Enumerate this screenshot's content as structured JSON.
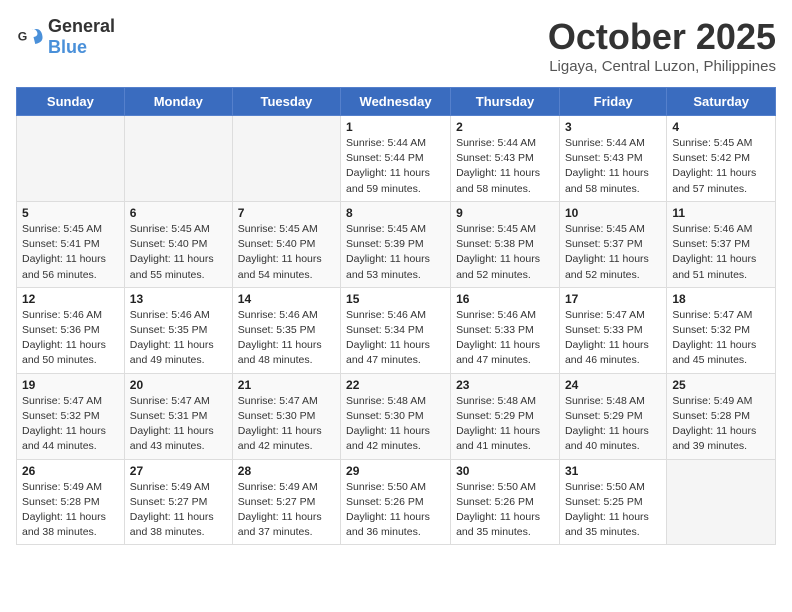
{
  "logo": {
    "text_general": "General",
    "text_blue": "Blue"
  },
  "header": {
    "month": "October 2025",
    "location": "Ligaya, Central Luzon, Philippines"
  },
  "weekdays": [
    "Sunday",
    "Monday",
    "Tuesday",
    "Wednesday",
    "Thursday",
    "Friday",
    "Saturday"
  ],
  "weeks": [
    [
      {
        "day": "",
        "sunrise": "",
        "sunset": "",
        "daylight": ""
      },
      {
        "day": "",
        "sunrise": "",
        "sunset": "",
        "daylight": ""
      },
      {
        "day": "",
        "sunrise": "",
        "sunset": "",
        "daylight": ""
      },
      {
        "day": "1",
        "sunrise": "Sunrise: 5:44 AM",
        "sunset": "Sunset: 5:44 PM",
        "daylight": "Daylight: 11 hours and 59 minutes."
      },
      {
        "day": "2",
        "sunrise": "Sunrise: 5:44 AM",
        "sunset": "Sunset: 5:43 PM",
        "daylight": "Daylight: 11 hours and 58 minutes."
      },
      {
        "day": "3",
        "sunrise": "Sunrise: 5:44 AM",
        "sunset": "Sunset: 5:43 PM",
        "daylight": "Daylight: 11 hours and 58 minutes."
      },
      {
        "day": "4",
        "sunrise": "Sunrise: 5:45 AM",
        "sunset": "Sunset: 5:42 PM",
        "daylight": "Daylight: 11 hours and 57 minutes."
      }
    ],
    [
      {
        "day": "5",
        "sunrise": "Sunrise: 5:45 AM",
        "sunset": "Sunset: 5:41 PM",
        "daylight": "Daylight: 11 hours and 56 minutes."
      },
      {
        "day": "6",
        "sunrise": "Sunrise: 5:45 AM",
        "sunset": "Sunset: 5:40 PM",
        "daylight": "Daylight: 11 hours and 55 minutes."
      },
      {
        "day": "7",
        "sunrise": "Sunrise: 5:45 AM",
        "sunset": "Sunset: 5:40 PM",
        "daylight": "Daylight: 11 hours and 54 minutes."
      },
      {
        "day": "8",
        "sunrise": "Sunrise: 5:45 AM",
        "sunset": "Sunset: 5:39 PM",
        "daylight": "Daylight: 11 hours and 53 minutes."
      },
      {
        "day": "9",
        "sunrise": "Sunrise: 5:45 AM",
        "sunset": "Sunset: 5:38 PM",
        "daylight": "Daylight: 11 hours and 52 minutes."
      },
      {
        "day": "10",
        "sunrise": "Sunrise: 5:45 AM",
        "sunset": "Sunset: 5:37 PM",
        "daylight": "Daylight: 11 hours and 52 minutes."
      },
      {
        "day": "11",
        "sunrise": "Sunrise: 5:46 AM",
        "sunset": "Sunset: 5:37 PM",
        "daylight": "Daylight: 11 hours and 51 minutes."
      }
    ],
    [
      {
        "day": "12",
        "sunrise": "Sunrise: 5:46 AM",
        "sunset": "Sunset: 5:36 PM",
        "daylight": "Daylight: 11 hours and 50 minutes."
      },
      {
        "day": "13",
        "sunrise": "Sunrise: 5:46 AM",
        "sunset": "Sunset: 5:35 PM",
        "daylight": "Daylight: 11 hours and 49 minutes."
      },
      {
        "day": "14",
        "sunrise": "Sunrise: 5:46 AM",
        "sunset": "Sunset: 5:35 PM",
        "daylight": "Daylight: 11 hours and 48 minutes."
      },
      {
        "day": "15",
        "sunrise": "Sunrise: 5:46 AM",
        "sunset": "Sunset: 5:34 PM",
        "daylight": "Daylight: 11 hours and 47 minutes."
      },
      {
        "day": "16",
        "sunrise": "Sunrise: 5:46 AM",
        "sunset": "Sunset: 5:33 PM",
        "daylight": "Daylight: 11 hours and 47 minutes."
      },
      {
        "day": "17",
        "sunrise": "Sunrise: 5:47 AM",
        "sunset": "Sunset: 5:33 PM",
        "daylight": "Daylight: 11 hours and 46 minutes."
      },
      {
        "day": "18",
        "sunrise": "Sunrise: 5:47 AM",
        "sunset": "Sunset: 5:32 PM",
        "daylight": "Daylight: 11 hours and 45 minutes."
      }
    ],
    [
      {
        "day": "19",
        "sunrise": "Sunrise: 5:47 AM",
        "sunset": "Sunset: 5:32 PM",
        "daylight": "Daylight: 11 hours and 44 minutes."
      },
      {
        "day": "20",
        "sunrise": "Sunrise: 5:47 AM",
        "sunset": "Sunset: 5:31 PM",
        "daylight": "Daylight: 11 hours and 43 minutes."
      },
      {
        "day": "21",
        "sunrise": "Sunrise: 5:47 AM",
        "sunset": "Sunset: 5:30 PM",
        "daylight": "Daylight: 11 hours and 42 minutes."
      },
      {
        "day": "22",
        "sunrise": "Sunrise: 5:48 AM",
        "sunset": "Sunset: 5:30 PM",
        "daylight": "Daylight: 11 hours and 42 minutes."
      },
      {
        "day": "23",
        "sunrise": "Sunrise: 5:48 AM",
        "sunset": "Sunset: 5:29 PM",
        "daylight": "Daylight: 11 hours and 41 minutes."
      },
      {
        "day": "24",
        "sunrise": "Sunrise: 5:48 AM",
        "sunset": "Sunset: 5:29 PM",
        "daylight": "Daylight: 11 hours and 40 minutes."
      },
      {
        "day": "25",
        "sunrise": "Sunrise: 5:49 AM",
        "sunset": "Sunset: 5:28 PM",
        "daylight": "Daylight: 11 hours and 39 minutes."
      }
    ],
    [
      {
        "day": "26",
        "sunrise": "Sunrise: 5:49 AM",
        "sunset": "Sunset: 5:28 PM",
        "daylight": "Daylight: 11 hours and 38 minutes."
      },
      {
        "day": "27",
        "sunrise": "Sunrise: 5:49 AM",
        "sunset": "Sunset: 5:27 PM",
        "daylight": "Daylight: 11 hours and 38 minutes."
      },
      {
        "day": "28",
        "sunrise": "Sunrise: 5:49 AM",
        "sunset": "Sunset: 5:27 PM",
        "daylight": "Daylight: 11 hours and 37 minutes."
      },
      {
        "day": "29",
        "sunrise": "Sunrise: 5:50 AM",
        "sunset": "Sunset: 5:26 PM",
        "daylight": "Daylight: 11 hours and 36 minutes."
      },
      {
        "day": "30",
        "sunrise": "Sunrise: 5:50 AM",
        "sunset": "Sunset: 5:26 PM",
        "daylight": "Daylight: 11 hours and 35 minutes."
      },
      {
        "day": "31",
        "sunrise": "Sunrise: 5:50 AM",
        "sunset": "Sunset: 5:25 PM",
        "daylight": "Daylight: 11 hours and 35 minutes."
      },
      {
        "day": "",
        "sunrise": "",
        "sunset": "",
        "daylight": ""
      }
    ]
  ]
}
